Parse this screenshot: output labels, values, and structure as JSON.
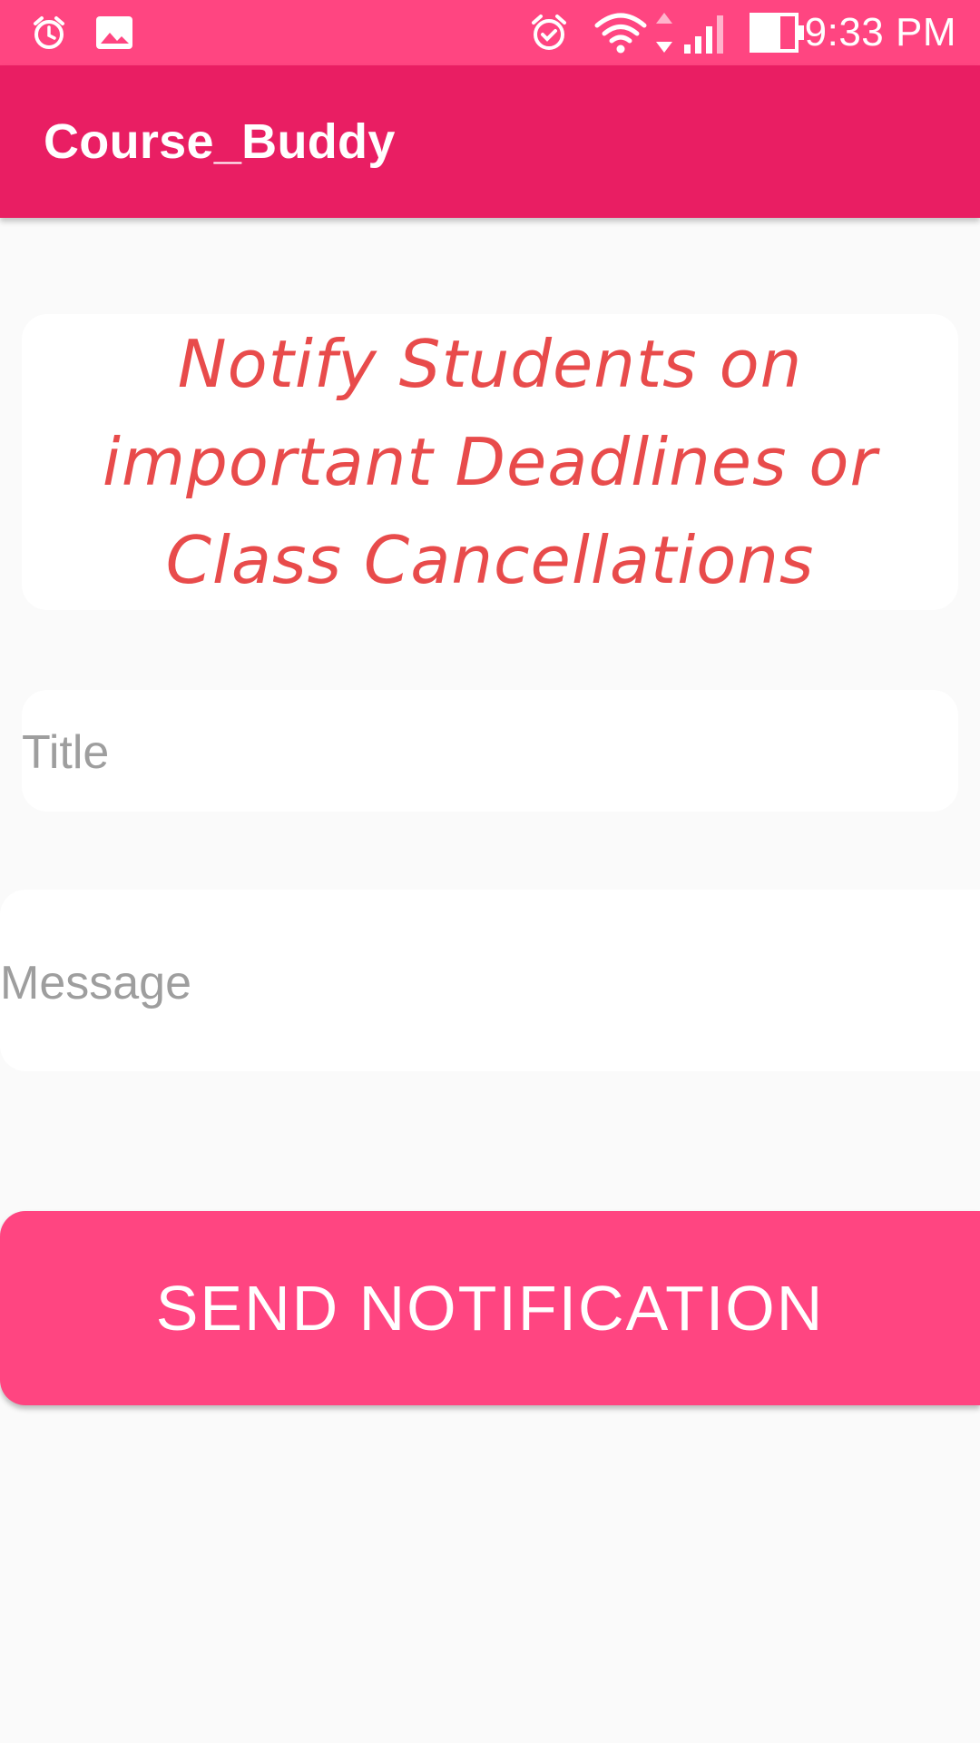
{
  "status_bar": {
    "time": "9:33 PM",
    "icons": [
      "alarm-icon",
      "image-icon",
      "alarm-check-icon",
      "wifi-icon",
      "signal-icon",
      "battery-icon"
    ]
  },
  "app_bar": {
    "title": "Course_Buddy"
  },
  "header": {
    "text": "Notify Students on important Deadlines or Class Cancellations",
    "color": "#e84b4b"
  },
  "form": {
    "title_placeholder": "Title",
    "message_placeholder": "Message"
  },
  "send_button": {
    "label": "SEND NOTIFICATION"
  },
  "colors": {
    "status_bar": "#ff4581",
    "app_bar": "#e91e63",
    "accent": "#ff4581",
    "background": "#fafafa"
  }
}
